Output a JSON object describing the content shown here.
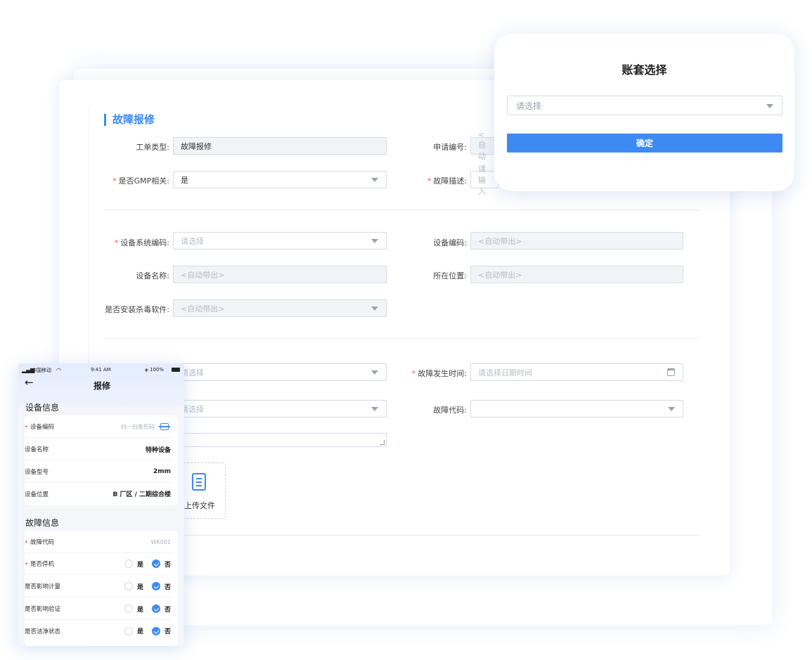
{
  "form": {
    "section_title": "故障报修",
    "order_type_label": "工单类型:",
    "order_type_value": "故障报修",
    "apply_no_label": "申请编号:",
    "apply_no_value": "<自动",
    "gmp_label": "是否GMP相关:",
    "gmp_value": "是",
    "fault_desc_label": "故障描述:",
    "fault_desc_placeholder": "请输入",
    "sys_code_label": "设备系统编码:",
    "sys_code_placeholder": "请选择",
    "equip_code_label": "设备编码:",
    "equip_code_value": "<自动带出>",
    "equip_name_label": "设备名称:",
    "equip_name_value": "<自动带出>",
    "location_label": "所在位置:",
    "location_value": "<自动带出>",
    "antivirus_label": "是否安装杀毒软件:",
    "antivirus_value": "<自动带出>",
    "select_a_placeholder": "请选择",
    "fault_time_label": "故障发生时间:",
    "fault_time_placeholder": "请选择日期时间",
    "select_b_placeholder": "请选择",
    "fault_code_label": "故障代码:",
    "fault_code_value": "",
    "upload_label": "上传文件"
  },
  "popup": {
    "title": "账套选择",
    "select_placeholder": "请选择",
    "confirm_label": "确定"
  },
  "phone": {
    "carrier": "中国移动",
    "time": "9:41 AM",
    "battery": "100%",
    "title": "报修",
    "equip_section": "设备信息",
    "equip_rows": [
      {
        "label": "设备编码",
        "value": "扫一扫条形码"
      },
      {
        "label": "设备名称",
        "value": "特种设备"
      },
      {
        "label": "设备型号",
        "value": "2mm"
      },
      {
        "label": "设备位置",
        "value": "B 厂区 / 二期综合楼"
      }
    ],
    "fault_section": "故障信息",
    "fault_code": {
      "label": "故障代码",
      "value": "WK001"
    },
    "yes_label": "是",
    "no_label": "否",
    "fault_rows": [
      {
        "label": "是否停机"
      },
      {
        "label": "是否影响计量"
      },
      {
        "label": "是否影响验证"
      },
      {
        "label": "是否洁净状态"
      }
    ]
  }
}
